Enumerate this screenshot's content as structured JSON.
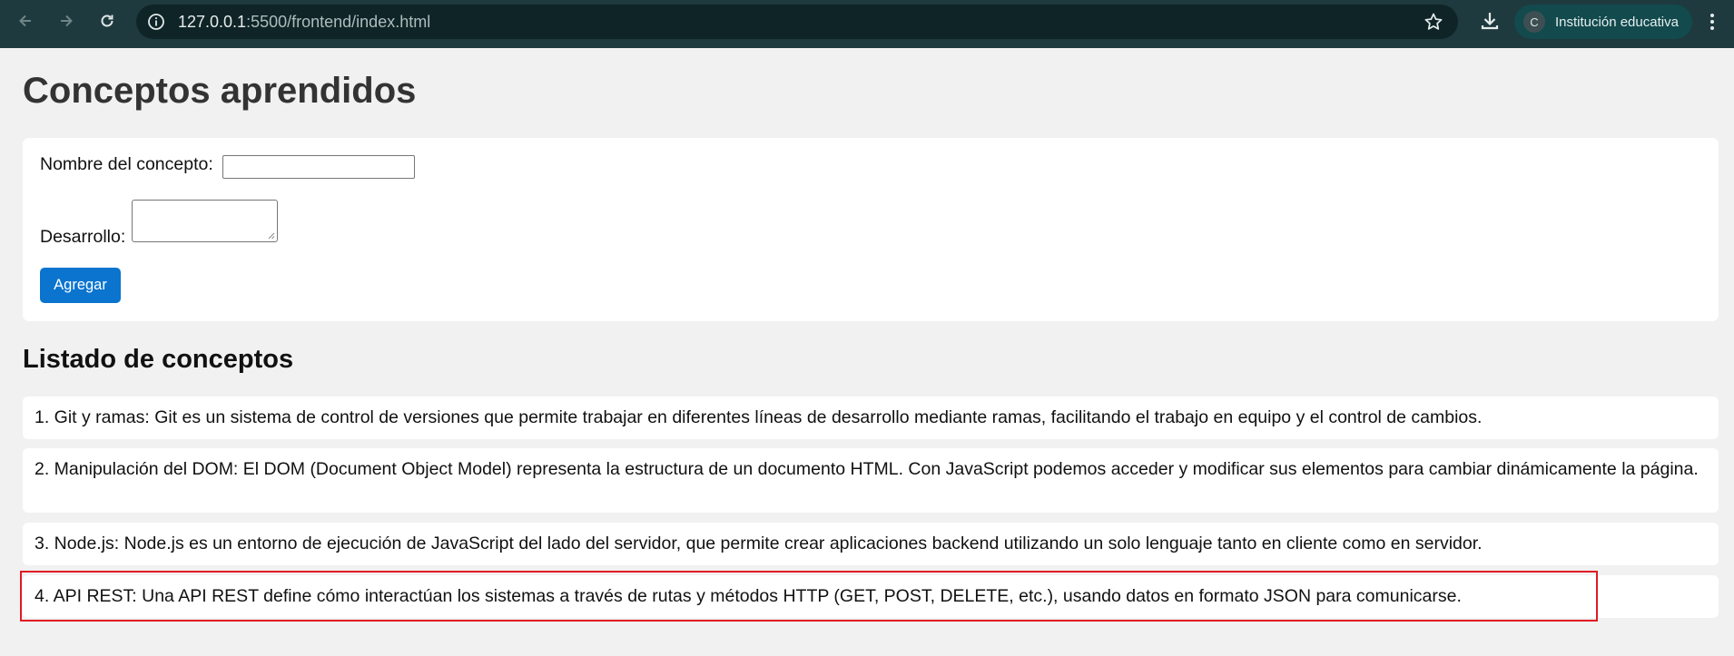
{
  "browser": {
    "url_host": "127.0.0.1",
    "url_rest": ":5500/frontend/index.html",
    "profile_initial": "C",
    "profile_name": "Institución educativa"
  },
  "page": {
    "title": "Conceptos aprendidos",
    "form": {
      "name_label": "Nombre del concepto:",
      "name_value": "",
      "dev_label": "Desarrollo:",
      "dev_value": "",
      "add_button": "Agregar"
    },
    "list_title": "Listado de conceptos",
    "items": [
      "1. Git y ramas: Git es un sistema de control de versiones que permite trabajar en diferentes líneas de desarrollo mediante ramas, facilitando el trabajo en equipo y el control de cambios.",
      "2. Manipulación del DOM: El DOM (Document Object Model) representa la estructura de un documento HTML. Con JavaScript podemos acceder y modificar sus elementos para cambiar dinámicamente la página.",
      "3. Node.js: Node.js es un entorno de ejecución de JavaScript del lado del servidor, que permite crear aplicaciones backend utilizando un solo lenguaje tanto en cliente como en servidor.",
      "4. API REST: Una API REST define cómo interactúan los sistemas a través de rutas y métodos HTTP (GET, POST, DELETE, etc.), usando datos en formato JSON para comunicarse."
    ]
  },
  "colors": {
    "chrome_bg": "#1e3a3e",
    "button_bg": "#0a74cf",
    "highlight": "#e01b24"
  }
}
